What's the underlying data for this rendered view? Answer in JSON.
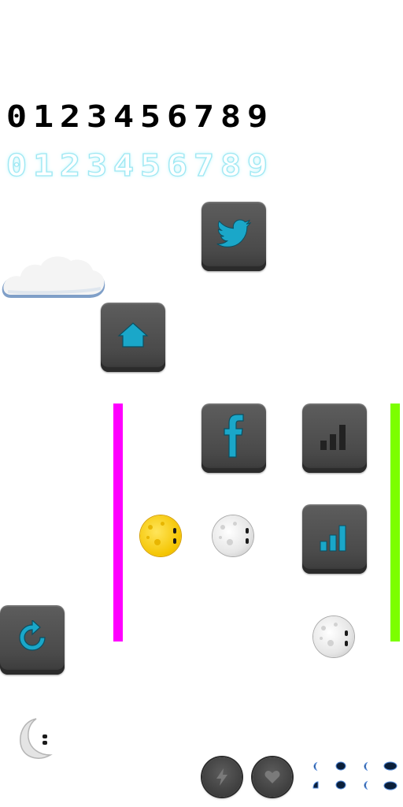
{
  "digits_black": [
    "0",
    "1",
    "2",
    "3",
    "4",
    "5",
    "6",
    "7",
    "8",
    "9"
  ],
  "digits_glow": [
    "0",
    "1",
    "2",
    "3",
    "4",
    "5",
    "6",
    "7",
    "8",
    "9"
  ],
  "colors": {
    "accent_teal": "#1aa7c9",
    "bar_magenta": "#ff00ff",
    "bar_green": "#7cff00",
    "button_dark": "#4a4a4a"
  },
  "icons": {
    "twitter": "twitter-bird-icon",
    "home": "home-icon",
    "facebook": "facebook-f-icon",
    "signal_dark": "signal-bars-icon",
    "signal_teal": "signal-bars-icon",
    "refresh": "refresh-icon",
    "lightning": "lightning-icon",
    "heart": "heart-icon",
    "cloud": "cloud-icon",
    "moon_yellow": "moon-face-icon",
    "moon_grey": "moon-face-icon",
    "moon_crescent": "crescent-moon-icon",
    "eyes": "eyes-sprite-icon"
  }
}
